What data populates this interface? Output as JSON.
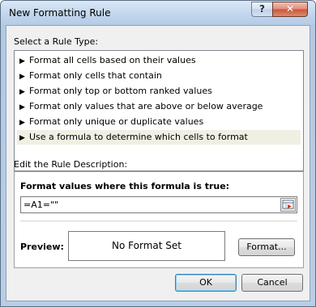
{
  "window": {
    "title": "New Formatting Rule",
    "help_label": "?",
    "close_label": "✕"
  },
  "rule_type": {
    "heading": "Select a Rule Type:",
    "items": [
      "Format all cells based on their values",
      "Format only cells that contain",
      "Format only top or bottom ranked values",
      "Format only values that are above or below average",
      "Format only unique or duplicate values",
      "Use a formula to determine which cells to format"
    ],
    "selected_index": 5
  },
  "description": {
    "heading": "Edit the Rule Description:",
    "formula_label": "Format values where this formula is true:",
    "formula_value": "=A1=\"\"",
    "preview_label": "Preview:",
    "preview_text": "No Format Set",
    "format_button": "Format..."
  },
  "buttons": {
    "ok": "OK",
    "cancel": "Cancel"
  }
}
